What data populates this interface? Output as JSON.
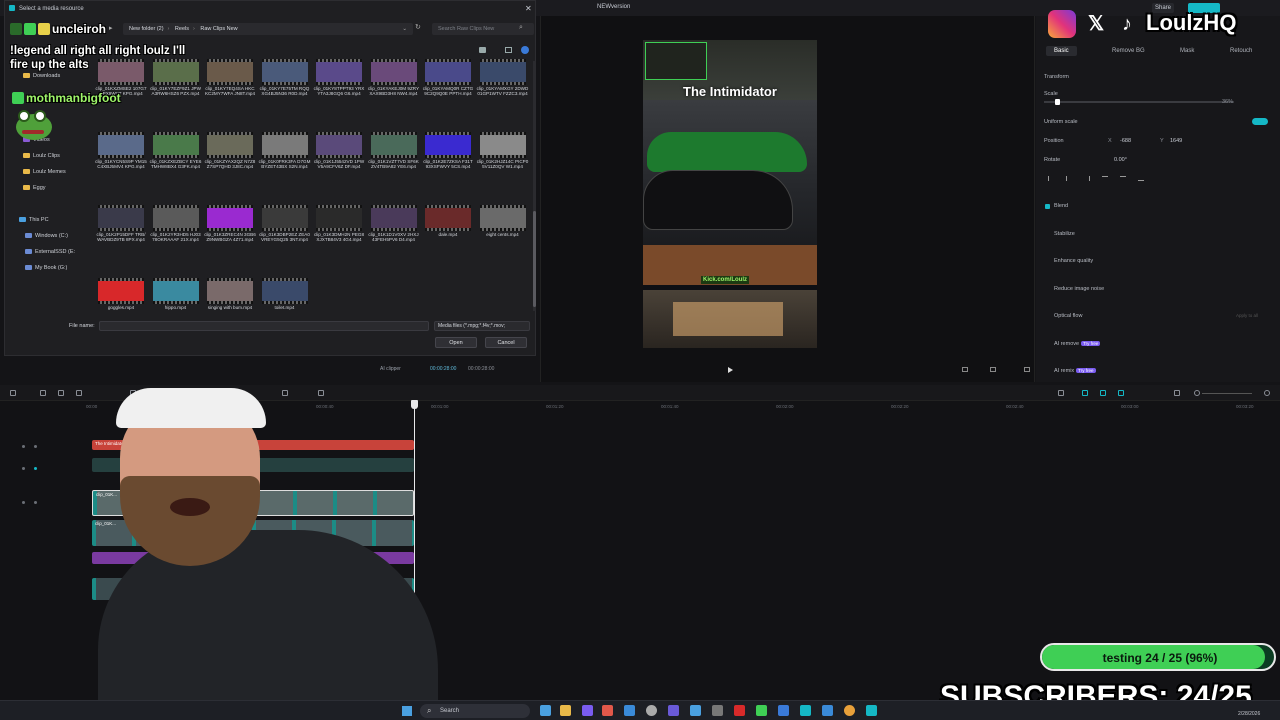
{
  "editor": {
    "title": "NEWversion",
    "share_label": "Share",
    "preview_title": "The Intimidator",
    "preview_watermark": "Kick.com/Loulz",
    "timecode_current": "00:00:28:00",
    "timecode_total": "00:00:28:00",
    "ai_clipper_label": "AI clipper",
    "ruler_labels": [
      "00:00",
      "00:00:20",
      "00:00:40",
      "00:01:00",
      "00:01:20",
      "00:01:40",
      "00:02:00",
      "00:02:20",
      "00:02:40",
      "00:03:00",
      "00:03:20"
    ],
    "clips": {
      "title_clip": "The Intimidator",
      "video_clip_1": "clip_01K...",
      "video_clip_2": "clip_01K..."
    }
  },
  "right_panel": {
    "tabs": [
      "Basic",
      "Remove BG",
      "Mask",
      "Retouch"
    ],
    "transform_label": "Transform",
    "scale_label": "Scale",
    "scale_value": "36%",
    "uniform_scale_label": "Uniform scale",
    "position_label": "Position",
    "position_x_label": "X",
    "position_x": "-688",
    "position_y_label": "Y",
    "position_y": "1649",
    "rotate_label": "Rotate",
    "rotate_value": "0.00°",
    "blend_label": "Blend",
    "stabilize_label": "Stabilize",
    "enhance_label": "Enhance quality",
    "noise_label": "Reduce image noise",
    "optical_flow_label": "Optical flow",
    "ai_remove_label": "AI remove",
    "ai_remix_label": "AI remix",
    "try_label": "Try free",
    "apply_all_label": "Apply to all"
  },
  "dialog": {
    "title": "Select a media resource",
    "breadcrumb": [
      "New folder (2)",
      "Reels",
      "Raw Clips New"
    ],
    "search_placeholder": "Search Raw Clips New",
    "nav": [
      {
        "label": "Downloads",
        "type": "folder"
      },
      {
        "label": "Music",
        "type": "music"
      },
      {
        "label": "Videos",
        "type": "video"
      },
      {
        "label": "Loulz Clips",
        "type": "folder"
      },
      {
        "label": "Loulz Memes",
        "type": "folder"
      },
      {
        "label": "Eggy",
        "type": "folder"
      },
      {
        "label": "This PC",
        "type": "pc"
      },
      {
        "label": "Windows (C:)",
        "type": "drive"
      },
      {
        "label": "ExternalSSD (E:",
        "type": "drive"
      },
      {
        "label": "My Book (G:)",
        "type": "drive"
      }
    ],
    "files": [
      {
        "name": "clip_01KXZMSE2 107G7HPX9WYT KPG.mp4",
        "color": "#7a5a6a"
      },
      {
        "name": "clip_01KY7EZF9Z1 JPWA3RW6HSZ6 PZX.mp4",
        "color": "#5a6e4a"
      },
      {
        "name": "clip_01KY7EQ4SA HKCKC2MY7WFA JN8T.mp4",
        "color": "#6a5a4a"
      },
      {
        "name": "clip_01KY7E75TM RQQXG4BJ5N36 R0D.mp4",
        "color": "#4a5a7a"
      },
      {
        "name": "clip_01KY8TPPT93 YRXYTA3J8GQ6 G6.mp4",
        "color": "#5a4a8a"
      },
      {
        "name": "clip_01KYAKEJ0M 9ZRYXAX9BD3H8 NW4.mp4",
        "color": "#6a4a7a"
      },
      {
        "name": "clip_01KYAMQ0R CZTG9C2Q9Q0E PPTH.mp4",
        "color": "#4a4a8a"
      },
      {
        "name": "clip_01KYAMXGY 2DWD01GP1WTV FZZC3.mp4",
        "color": "#3a4a6a"
      },
      {
        "name": "clip_01KYCN5S9P YM15C4XBJ5MV4 KPG.mp4",
        "color": "#5a6a8a"
      },
      {
        "name": "clip_01KZXEZBCY EYE6TMHW8BX4 G3FK.mp4",
        "color": "#4a7a4a"
      },
      {
        "name": "clip_01KZYAX2QZ N7Z8Z7SP7QHD 3J8C.mp4",
        "color": "#6a6a5a"
      },
      {
        "name": "clip_01K0FRK3FA D7GMBYZET43BX S2N.mp4",
        "color": "#7a7a7a"
      },
      {
        "name": "clip_01K1J5542VD 1PWV5A9CFV6Z DF.mp4",
        "color": "#5a4a7a"
      },
      {
        "name": "clip_01K1VZT7VD SF6KZV4TB9A82 YE6.mp4",
        "color": "#4a6a5a"
      },
      {
        "name": "clip_01K2E7ZKSA F31T93XSFWVY 5CS.mp4",
        "color": "#3a2ad0"
      },
      {
        "name": "clip_01K2HJZ14C PICP05V11Z0QV W1.mp4",
        "color": "#8a8a8a"
      },
      {
        "name": "clip_01K2P15DFF TRB/WAVBDZ9TB 8PX.mp4",
        "color": "#3a3a4a"
      },
      {
        "name": "clip_01K2YR3HD5 HJ0378OKRAAAF 21X.mp4",
        "color": "#5a5a5a"
      },
      {
        "name": "clip_01K3ZREC4N 3GB6Z9NWBGZA 4Z71.mp4",
        "color": "#9a2ad0"
      },
      {
        "name": "clip_01K3DBP2EZ ZEA0VREYG5Q25 3NT.mp4",
        "color": "#3a3a3a"
      },
      {
        "name": "clip_01K3DMH2N PEG8XJXTB84V3 4G4.mp4",
        "color": "#2a2a2a"
      },
      {
        "name": "clip_01K1D1V0XV 2HXJ43FEH5PV6 D4.mp4",
        "color": "#4a3a5a"
      },
      {
        "name": "dale.mp4",
        "color": "#6a2a2a"
      },
      {
        "name": "eight cents.mp4",
        "color": "#6a6a6a"
      },
      {
        "name": "goggles.mp4",
        "color": "#d8282a"
      },
      {
        "name": "hippo.mp4",
        "color": "#3a8aa0"
      },
      {
        "name": "singing with bum.mp4",
        "color": "#7a6a6a"
      },
      {
        "name": "toilet.mp4",
        "color": "#3a4a6a"
      }
    ],
    "filename_label": "File name:",
    "filename_value": "",
    "filetype_label": "Media files (*.mpg;*.f4v;*.mov;",
    "open_label": "Open",
    "cancel_label": "Cancel"
  },
  "overlay": {
    "chat_user1": "uncleiroh",
    "chat_message": "!legend all right all right loulz I'll fire up the alts",
    "chat_user2": "mothmanbigfoot",
    "social_handle": "LoulzHQ",
    "goal_label": "testing 24 / 25 (96%)",
    "goal_progress": 0.96,
    "subscribers_label": "SUBSCRIBERS: 24/25"
  },
  "taskbar": {
    "search_label": "Search",
    "date": "2/28/2026"
  },
  "colors": {
    "accent": "#15b8c6",
    "goal_fill": "#3fcf55",
    "timeline_title_clip": "#c8433a",
    "timeline_video_clip": "#1c8c86"
  }
}
